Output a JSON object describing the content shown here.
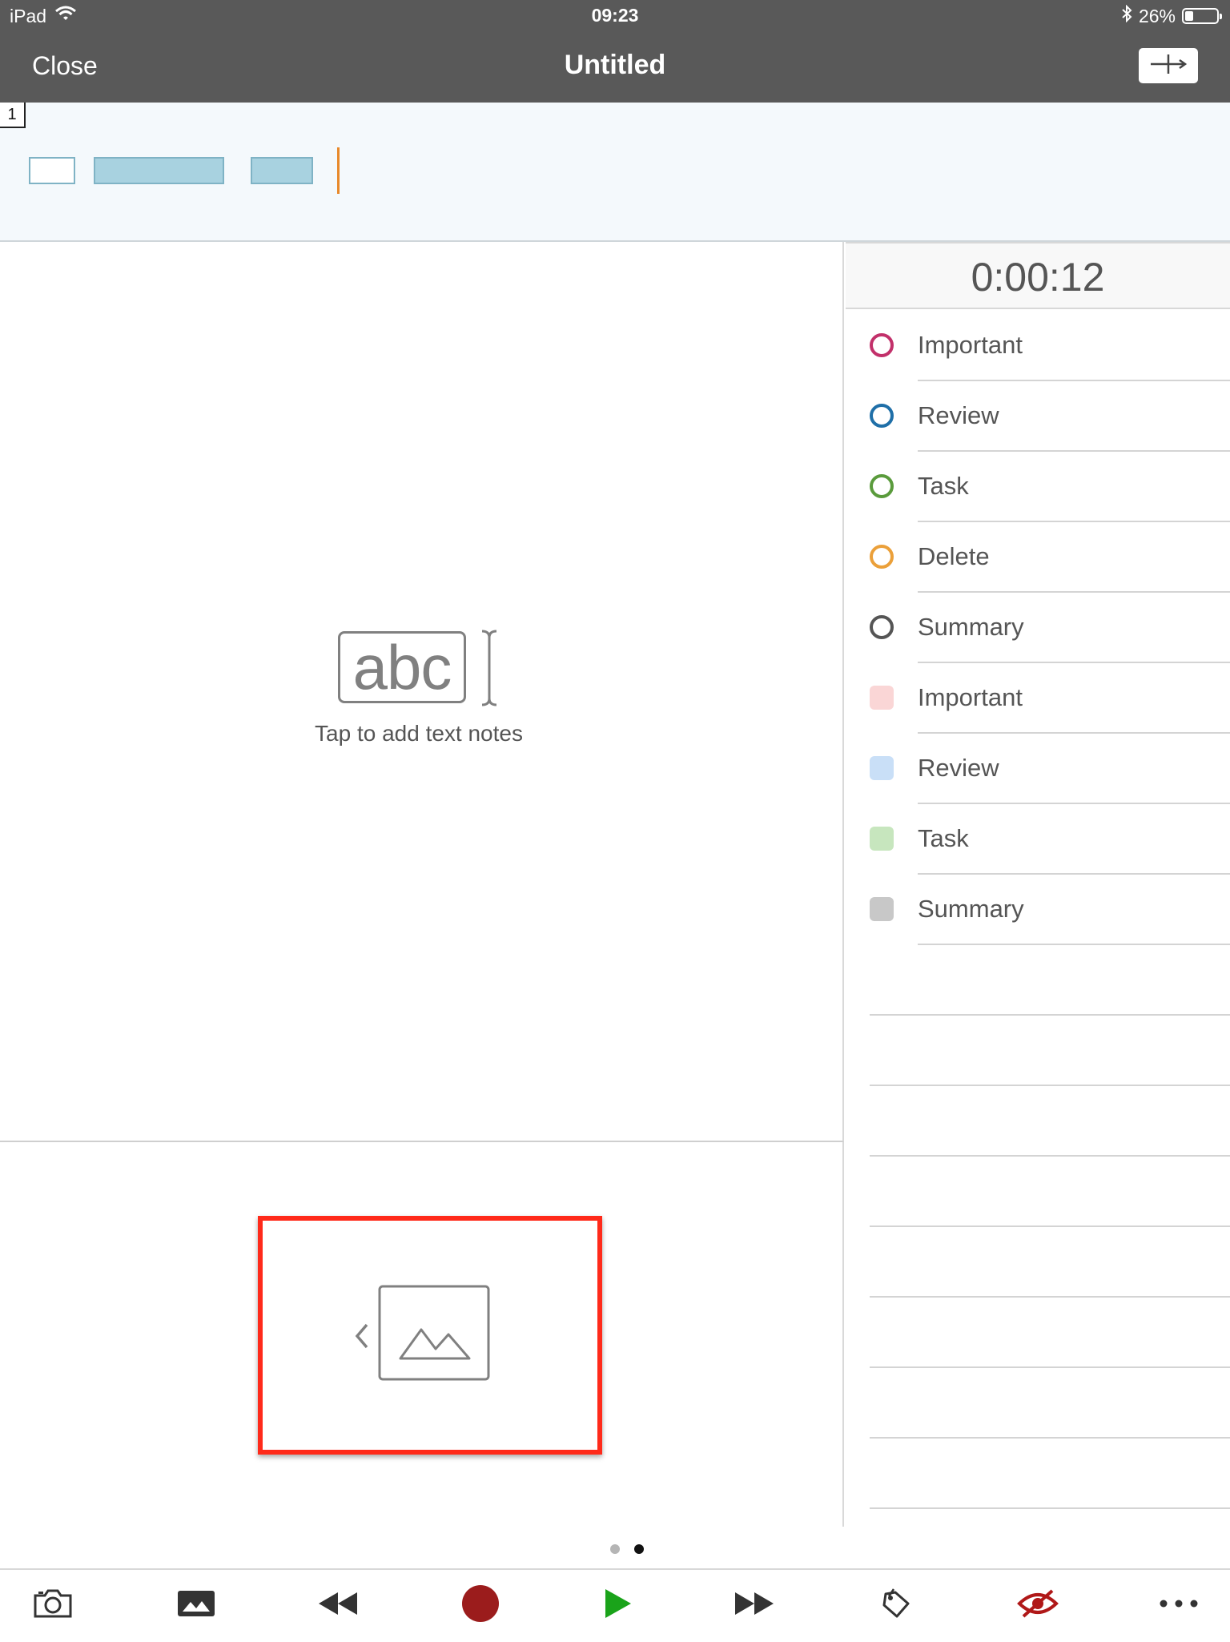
{
  "status_bar": {
    "device": "iPad",
    "time": "09:23",
    "battery": "26%",
    "battery_level": 0.26
  },
  "nav": {
    "close_label": "Close",
    "title": "Untitled",
    "action_icon": "split-timeline-icon"
  },
  "timeline": {
    "page_number": "1",
    "accent_color": "#e8892a",
    "segment_color": "#a8d2e0"
  },
  "notes": {
    "abc_label": "abc",
    "hint": "Tap to add text notes"
  },
  "right_panel": {
    "timer": "0:00:12",
    "tags": [
      {
        "label": "Important",
        "shape": "circle",
        "color": "#c2306a"
      },
      {
        "label": "Review",
        "shape": "circle",
        "color": "#1f6fa8"
      },
      {
        "label": "Task",
        "shape": "circle",
        "color": "#5a9b3c"
      },
      {
        "label": "Delete",
        "shape": "circle",
        "color": "#eba03a"
      },
      {
        "label": "Summary",
        "shape": "circle",
        "color": "#555555"
      },
      {
        "label": "Important",
        "shape": "square",
        "color": "#fad6d6"
      },
      {
        "label": "Review",
        "shape": "square",
        "color": "#c9dff7"
      },
      {
        "label": "Task",
        "shape": "square",
        "color": "#c7e6be"
      },
      {
        "label": "Summary",
        "shape": "square",
        "color": "#c8c8c8"
      }
    ]
  },
  "pager": {
    "pages": 2,
    "active_page": 2
  },
  "toolbar": {
    "items": [
      "camera-icon",
      "photo-icon",
      "rewind-icon",
      "record-icon",
      "play-icon",
      "fast-forward-icon",
      "tag-icon",
      "hide-icon",
      "more-icon"
    ],
    "record_color": "#9b1c1c",
    "play_color": "#1aa31a",
    "hide_color": "#b01818"
  }
}
